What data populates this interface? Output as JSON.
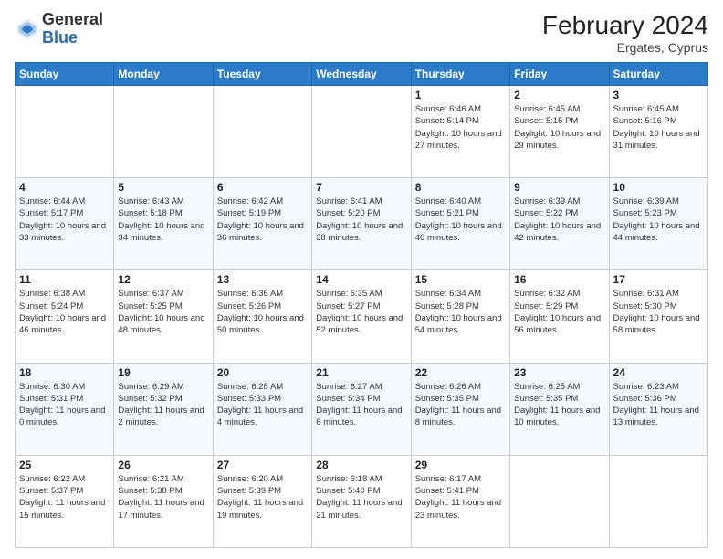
{
  "header": {
    "logo": {
      "general": "General",
      "blue": "Blue"
    },
    "title": "February 2024",
    "subtitle": "Ergates, Cyprus"
  },
  "days_of_week": [
    "Sunday",
    "Monday",
    "Tuesday",
    "Wednesday",
    "Thursday",
    "Friday",
    "Saturday"
  ],
  "weeks": [
    [
      {
        "day": "",
        "info": ""
      },
      {
        "day": "",
        "info": ""
      },
      {
        "day": "",
        "info": ""
      },
      {
        "day": "",
        "info": ""
      },
      {
        "day": "1",
        "info": "Sunrise: 6:46 AM\nSunset: 5:14 PM\nDaylight: 10 hours\nand 27 minutes."
      },
      {
        "day": "2",
        "info": "Sunrise: 6:45 AM\nSunset: 5:15 PM\nDaylight: 10 hours\nand 29 minutes."
      },
      {
        "day": "3",
        "info": "Sunrise: 6:45 AM\nSunset: 5:16 PM\nDaylight: 10 hours\nand 31 minutes."
      }
    ],
    [
      {
        "day": "4",
        "info": "Sunrise: 6:44 AM\nSunset: 5:17 PM\nDaylight: 10 hours\nand 33 minutes."
      },
      {
        "day": "5",
        "info": "Sunrise: 6:43 AM\nSunset: 5:18 PM\nDaylight: 10 hours\nand 34 minutes."
      },
      {
        "day": "6",
        "info": "Sunrise: 6:42 AM\nSunset: 5:19 PM\nDaylight: 10 hours\nand 36 minutes."
      },
      {
        "day": "7",
        "info": "Sunrise: 6:41 AM\nSunset: 5:20 PM\nDaylight: 10 hours\nand 38 minutes."
      },
      {
        "day": "8",
        "info": "Sunrise: 6:40 AM\nSunset: 5:21 PM\nDaylight: 10 hours\nand 40 minutes."
      },
      {
        "day": "9",
        "info": "Sunrise: 6:39 AM\nSunset: 5:22 PM\nDaylight: 10 hours\nand 42 minutes."
      },
      {
        "day": "10",
        "info": "Sunrise: 6:39 AM\nSunset: 5:23 PM\nDaylight: 10 hours\nand 44 minutes."
      }
    ],
    [
      {
        "day": "11",
        "info": "Sunrise: 6:38 AM\nSunset: 5:24 PM\nDaylight: 10 hours\nand 46 minutes."
      },
      {
        "day": "12",
        "info": "Sunrise: 6:37 AM\nSunset: 5:25 PM\nDaylight: 10 hours\nand 48 minutes."
      },
      {
        "day": "13",
        "info": "Sunrise: 6:36 AM\nSunset: 5:26 PM\nDaylight: 10 hours\nand 50 minutes."
      },
      {
        "day": "14",
        "info": "Sunrise: 6:35 AM\nSunset: 5:27 PM\nDaylight: 10 hours\nand 52 minutes."
      },
      {
        "day": "15",
        "info": "Sunrise: 6:34 AM\nSunset: 5:28 PM\nDaylight: 10 hours\nand 54 minutes."
      },
      {
        "day": "16",
        "info": "Sunrise: 6:32 AM\nSunset: 5:29 PM\nDaylight: 10 hours\nand 56 minutes."
      },
      {
        "day": "17",
        "info": "Sunrise: 6:31 AM\nSunset: 5:30 PM\nDaylight: 10 hours\nand 58 minutes."
      }
    ],
    [
      {
        "day": "18",
        "info": "Sunrise: 6:30 AM\nSunset: 5:31 PM\nDaylight: 11 hours\nand 0 minutes."
      },
      {
        "day": "19",
        "info": "Sunrise: 6:29 AM\nSunset: 5:32 PM\nDaylight: 11 hours\nand 2 minutes."
      },
      {
        "day": "20",
        "info": "Sunrise: 6:28 AM\nSunset: 5:33 PM\nDaylight: 11 hours\nand 4 minutes."
      },
      {
        "day": "21",
        "info": "Sunrise: 6:27 AM\nSunset: 5:34 PM\nDaylight: 11 hours\nand 6 minutes."
      },
      {
        "day": "22",
        "info": "Sunrise: 6:26 AM\nSunset: 5:35 PM\nDaylight: 11 hours\nand 8 minutes."
      },
      {
        "day": "23",
        "info": "Sunrise: 6:25 AM\nSunset: 5:35 PM\nDaylight: 11 hours\nand 10 minutes."
      },
      {
        "day": "24",
        "info": "Sunrise: 6:23 AM\nSunset: 5:36 PM\nDaylight: 11 hours\nand 13 minutes."
      }
    ],
    [
      {
        "day": "25",
        "info": "Sunrise: 6:22 AM\nSunset: 5:37 PM\nDaylight: 11 hours\nand 15 minutes."
      },
      {
        "day": "26",
        "info": "Sunrise: 6:21 AM\nSunset: 5:38 PM\nDaylight: 11 hours\nand 17 minutes."
      },
      {
        "day": "27",
        "info": "Sunrise: 6:20 AM\nSunset: 5:39 PM\nDaylight: 11 hours\nand 19 minutes."
      },
      {
        "day": "28",
        "info": "Sunrise: 6:18 AM\nSunset: 5:40 PM\nDaylight: 11 hours\nand 21 minutes."
      },
      {
        "day": "29",
        "info": "Sunrise: 6:17 AM\nSunset: 5:41 PM\nDaylight: 11 hours\nand 23 minutes."
      },
      {
        "day": "",
        "info": ""
      },
      {
        "day": "",
        "info": ""
      }
    ]
  ]
}
